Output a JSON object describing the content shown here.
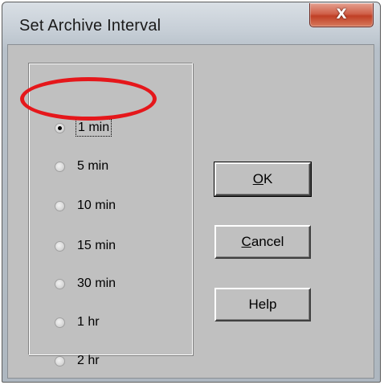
{
  "window": {
    "title": "Set Archive Interval",
    "close_glyph": "X"
  },
  "interval_options": [
    {
      "label": "1 min",
      "checked": true
    },
    {
      "label": "5 min",
      "checked": false
    },
    {
      "label": "10 min",
      "checked": false
    },
    {
      "label": "15 min",
      "checked": false
    },
    {
      "label": "30 min",
      "checked": false
    },
    {
      "label": "1 hr",
      "checked": false
    },
    {
      "label": "2 hr",
      "checked": false
    }
  ],
  "buttons": {
    "ok": {
      "mnemonic": "O",
      "rest": "K"
    },
    "cancel": {
      "mnemonic": "C",
      "rest": "ancel"
    },
    "help": {
      "label": "Help"
    }
  },
  "colors": {
    "dialog_bg": "#c0c0c0",
    "highlight_ring": "#e5171b",
    "close_button": "#c94a30"
  }
}
